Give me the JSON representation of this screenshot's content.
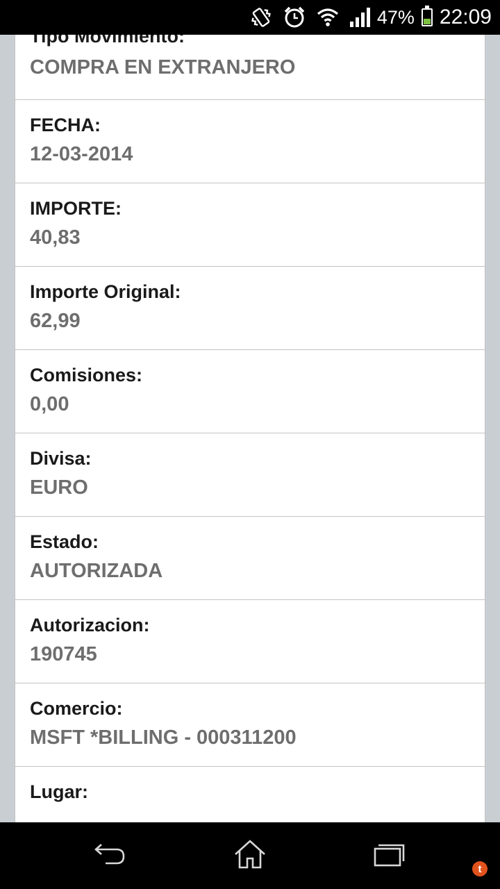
{
  "status_bar": {
    "battery_percent_text": "47%",
    "battery_level": 0.47,
    "time": "22:09",
    "icons": [
      "vibrate-icon",
      "alarm-icon",
      "wifi-icon",
      "signal-icon",
      "battery-icon"
    ]
  },
  "fields": [
    {
      "label": "Tipo Movimiento:",
      "value": "COMPRA EN EXTRANJERO"
    },
    {
      "label": "FECHA:",
      "value": "12-03-2014"
    },
    {
      "label": "IMPORTE:",
      "value": "40,83"
    },
    {
      "label": "Importe Original:",
      "value": "62,99"
    },
    {
      "label": "Comisiones:",
      "value": "0,00"
    },
    {
      "label": "Divisa:",
      "value": "EURO"
    },
    {
      "label": "Estado:",
      "value": "AUTORIZADA"
    },
    {
      "label": "Autorizacion:",
      "value": "190745"
    },
    {
      "label": "Comercio:",
      "value": "MSFT *BILLING - 000311200"
    },
    {
      "label": "Lugar:",
      "value": ""
    }
  ],
  "nav_bar": {
    "buttons": [
      "back-icon",
      "home-icon",
      "recent-apps-icon"
    ],
    "notification_badge": "t"
  },
  "colors": {
    "label": "#1a1a1a",
    "value": "#6e6e6e",
    "background": "#c9ced3",
    "battery_fill": "#7ec243",
    "notification": "#e2521d"
  }
}
